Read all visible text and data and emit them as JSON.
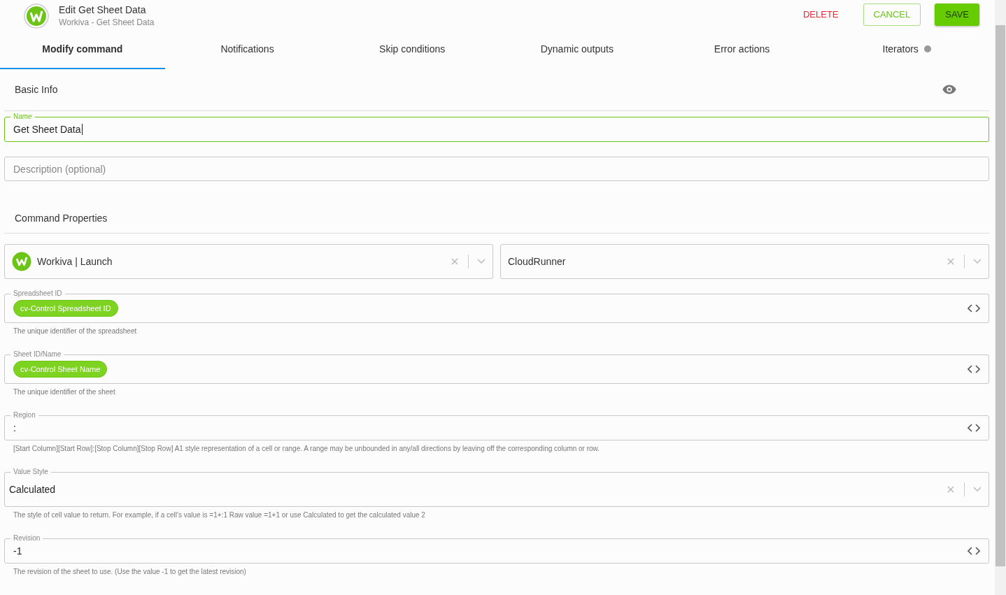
{
  "header": {
    "title": "Edit Get Sheet Data",
    "subtitle": "Workiva - Get Sheet Data",
    "buttons": [
      {
        "label": "DELETE",
        "kind": "danger"
      },
      {
        "label": "CANCEL",
        "kind": "outline"
      },
      {
        "label": "SAVE",
        "kind": "primary"
      }
    ]
  },
  "tabs": [
    {
      "label": "Modify command",
      "selected": true,
      "indicator": false
    },
    {
      "label": "Notifications",
      "selected": false,
      "indicator": false
    },
    {
      "label": "Skip conditions",
      "selected": false,
      "indicator": false
    },
    {
      "label": "Dynamic outputs",
      "selected": false,
      "indicator": false
    },
    {
      "label": "Error actions",
      "selected": false,
      "indicator": false
    },
    {
      "label": "Iterators",
      "selected": false,
      "indicator": true
    }
  ],
  "basic_info": {
    "title": "Basic Info",
    "name_field": {
      "label": "Name",
      "value": "Get Sheet Data",
      "focused": true
    },
    "description_field": {
      "placeholder": "Description (optional)"
    }
  },
  "command_properties": {
    "title": "Command Properties",
    "connector": {
      "value": "Workiva | Launch"
    },
    "runner": {
      "value": "CloudRunner"
    },
    "fields": [
      {
        "kind": "chip",
        "label": "Spreadsheet ID",
        "value": "cv-Control Spreadsheet ID",
        "hint": "The unique identifier of the spreadsheet"
      },
      {
        "kind": "chip",
        "label": "Sheet ID/Name",
        "value": "cv-Control Sheet Name",
        "hint": "The unique identifier of the sheet"
      },
      {
        "kind": "text",
        "label": "Region",
        "value": ":",
        "hint": "[Start Column][Start Row]:[Stop Column][Stop Row] A1 style representation of a cell or range. A range may be unbounded in any/all directions by leaving off the corresponding column or row."
      },
      {
        "kind": "select",
        "label": "Value Style",
        "value": "Calculated",
        "hint": "The style of cell value to return. For example, if a cell's value is =1+:1 Raw value =1+1 or use Calculated to get the calculated value 2"
      },
      {
        "kind": "text",
        "label": "Revision",
        "value": "-1",
        "hint": "The revision of the sheet to use. (Use the value -1 to get the latest revision)"
      }
    ]
  }
}
